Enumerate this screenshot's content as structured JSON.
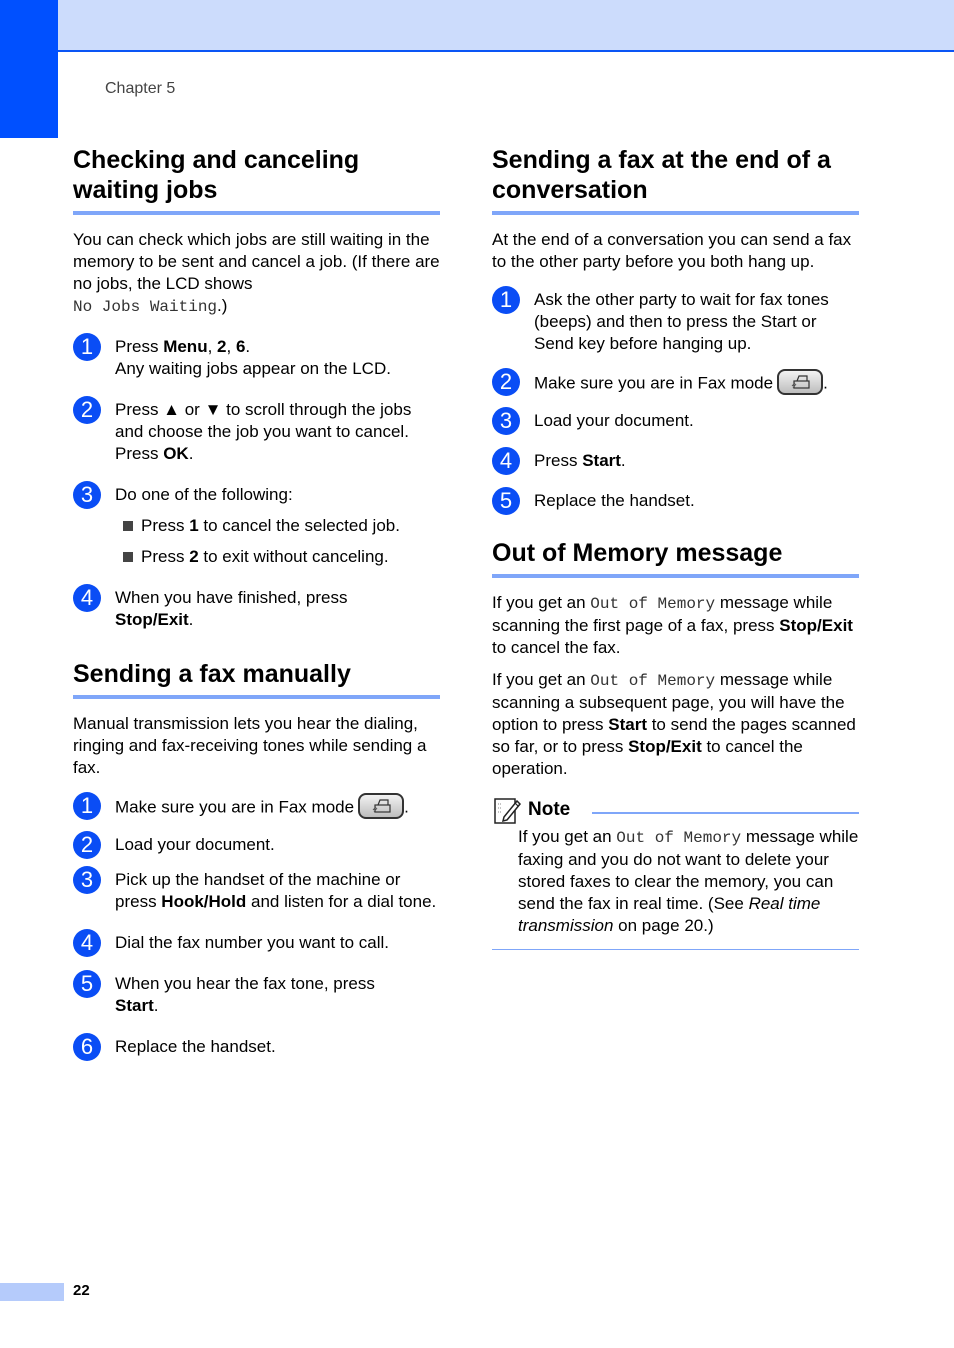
{
  "header": {
    "chapter": "Chapter 5"
  },
  "left": {
    "sec1": {
      "title": "Checking and canceling waiting jobs",
      "intro": "You can check which jobs are still waiting in the memory to be sent and cancel a job. (If there are no jobs, the LCD shows",
      "intro_lcd": "No Jobs Waiting",
      "intro_end": ".)",
      "steps": [
        {
          "n": "1",
          "a": "Press ",
          "b1": "Menu",
          "c": ", ",
          "b2": "2",
          "d": ", ",
          "b3": "6",
          "e": ".",
          "line2": "Any waiting jobs appear on the LCD."
        },
        {
          "n": "2",
          "a": "Press ▲ or ▼ to scroll through the jobs and choose the job you want to cancel. Press ",
          "b": "OK",
          "c": "."
        },
        {
          "n": "3",
          "a": "Do one of the following:",
          "subs": [
            {
              "a": "Press ",
              "b": "1",
              "c": " to cancel the selected job."
            },
            {
              "a": "Press ",
              "b": "2",
              "c": " to exit without canceling."
            }
          ]
        },
        {
          "n": "4",
          "a": "When you have finished, press ",
          "b": "Stop/Exit",
          "c": "."
        }
      ]
    },
    "sec2": {
      "title": "Sending a fax manually",
      "intro": "Manual transmission lets you hear the dialing, ringing and fax-receiving tones while sending a fax.",
      "steps": [
        {
          "n": "1",
          "a": "Make sure you are in Fax mode",
          "c": "."
        },
        {
          "n": "2",
          "a": "Load your document."
        },
        {
          "n": "3",
          "a": "Pick up the handset of the machine or press ",
          "b": "Hook/Hold",
          "c": " and listen for a dial tone."
        },
        {
          "n": "4",
          "a": "Dial the fax number you want to call."
        },
        {
          "n": "5",
          "a": "When you hear the fax tone, press ",
          "b": "Start",
          "c": "."
        },
        {
          "n": "6",
          "a": "Replace the handset."
        }
      ]
    }
  },
  "right": {
    "sec1": {
      "title": "Sending a fax at the end of a conversation",
      "intro": "At the end of a conversation you can send a fax to the other party before you both hang up.",
      "steps": [
        {
          "n": "1",
          "a": "Ask the other party to wait for fax tones (beeps) and then to press the Start or Send key before hanging up."
        },
        {
          "n": "2",
          "a": "Make sure you are in Fax mode",
          "c": "."
        },
        {
          "n": "3",
          "a": "Load your document."
        },
        {
          "n": "4",
          "a": "Press ",
          "b": "Start",
          "c": "."
        },
        {
          "n": "5",
          "a": "Replace the handset."
        }
      ]
    },
    "sec2": {
      "title": "Out of Memory message",
      "p1": {
        "a": "If you get an ",
        "lcd": "Out of Memory",
        "b": " message while scanning the first page of a fax, press ",
        "bold": "Stop/Exit",
        "c": " to cancel the fax."
      },
      "p2": {
        "a": "If you get an ",
        "lcd": "Out of Memory",
        "b": " message while scanning a subsequent page, you will have the option to press ",
        "bold1": "Start",
        "c": " to send the pages scanned so far, or to press ",
        "bold2": "Stop/Exit",
        "d": " to cancel the operation."
      },
      "note": {
        "title": "Note",
        "a": "If you get an ",
        "lcd": "Out of Memory",
        "b": " message while faxing and you do not want to delete your stored faxes to clear the memory, you can send the fax in real time. (See ",
        "ref": "Real time transmission",
        "c": " on page 20.)"
      }
    }
  },
  "footer": {
    "page": "22"
  },
  "colors": {
    "accent": "#0050ff",
    "band": "#ccdcfc",
    "rule": "#7fa6f9",
    "badge": "#0a4df5"
  }
}
